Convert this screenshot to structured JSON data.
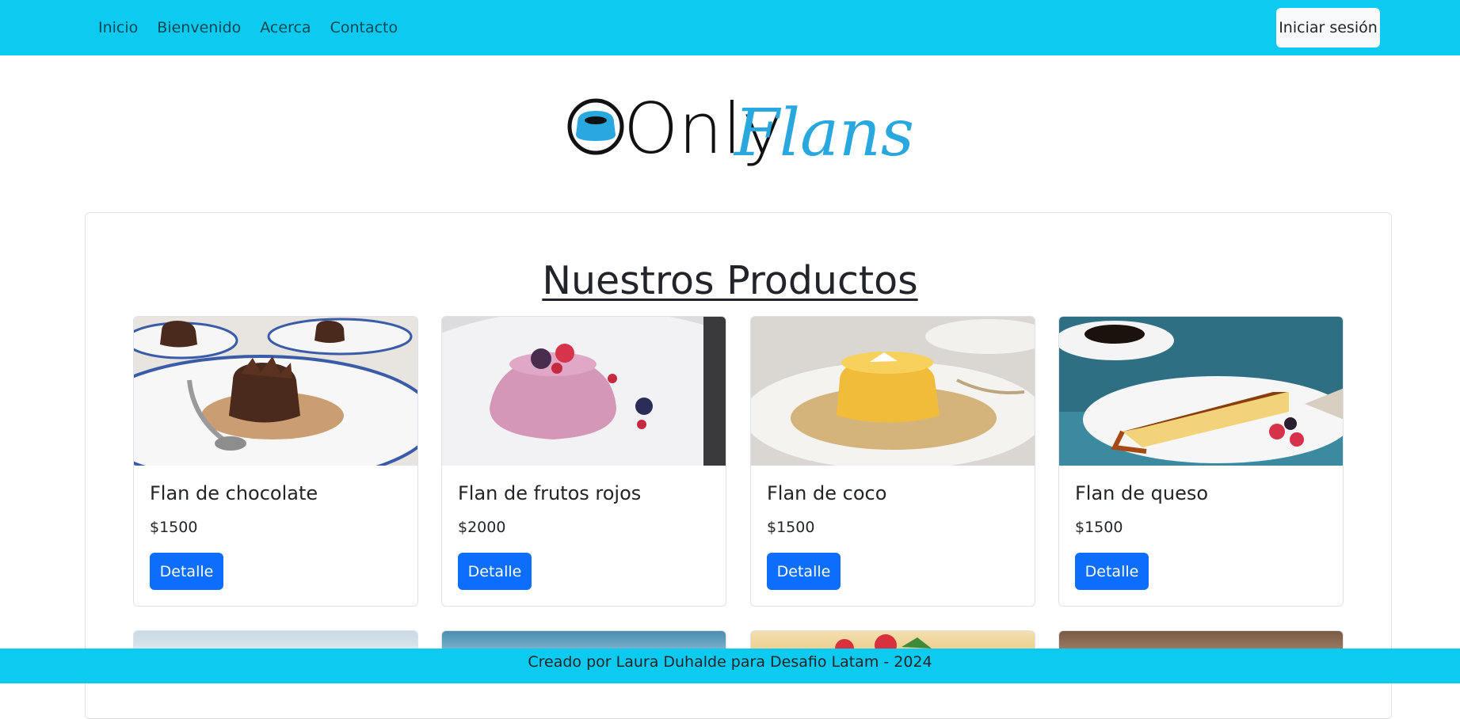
{
  "nav": {
    "links": [
      "Inicio",
      "Bienvenido",
      "Acerca",
      "Contacto"
    ],
    "login_label": "Iniciar sesión"
  },
  "logo": {
    "text_left": "Only",
    "text_right": "Flans"
  },
  "products": {
    "title": "Nuestros Productos",
    "button_label": "Detalle",
    "items": [
      {
        "name": "Flan de chocolate",
        "price": "$1500",
        "image": "chocolate-flan-image"
      },
      {
        "name": "Flan de frutos rojos",
        "price": "$2000",
        "image": "berry-flan-image"
      },
      {
        "name": "Flan de coco",
        "price": "$1500",
        "image": "coconut-flan-image"
      },
      {
        "name": "Flan de queso",
        "price": "$1500",
        "image": "cheese-flan-image"
      }
    ]
  },
  "footer": {
    "text": "Creado por Laura Duhalde para Desafio Latam - 2024"
  },
  "colors": {
    "navbar": "#0dcaf0",
    "primary_button": "#0d6efd",
    "logo_accent": "#29a8e0"
  }
}
